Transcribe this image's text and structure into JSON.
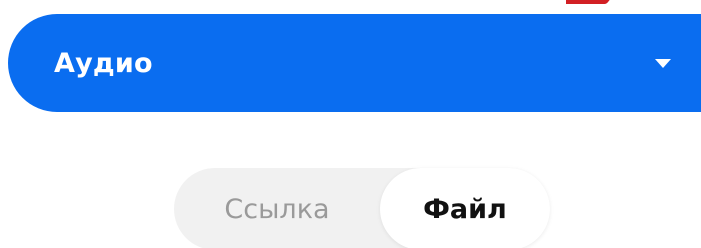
{
  "dropdown": {
    "selected": "Аудио",
    "icon": "caret-down-icon",
    "accent_color": "#0a6df0"
  },
  "toggle": {
    "options": [
      {
        "label": "Ссылка",
        "selected": false
      },
      {
        "label": "Файл",
        "selected": true
      }
    ]
  },
  "annotation": {
    "color": "#d21f24"
  }
}
